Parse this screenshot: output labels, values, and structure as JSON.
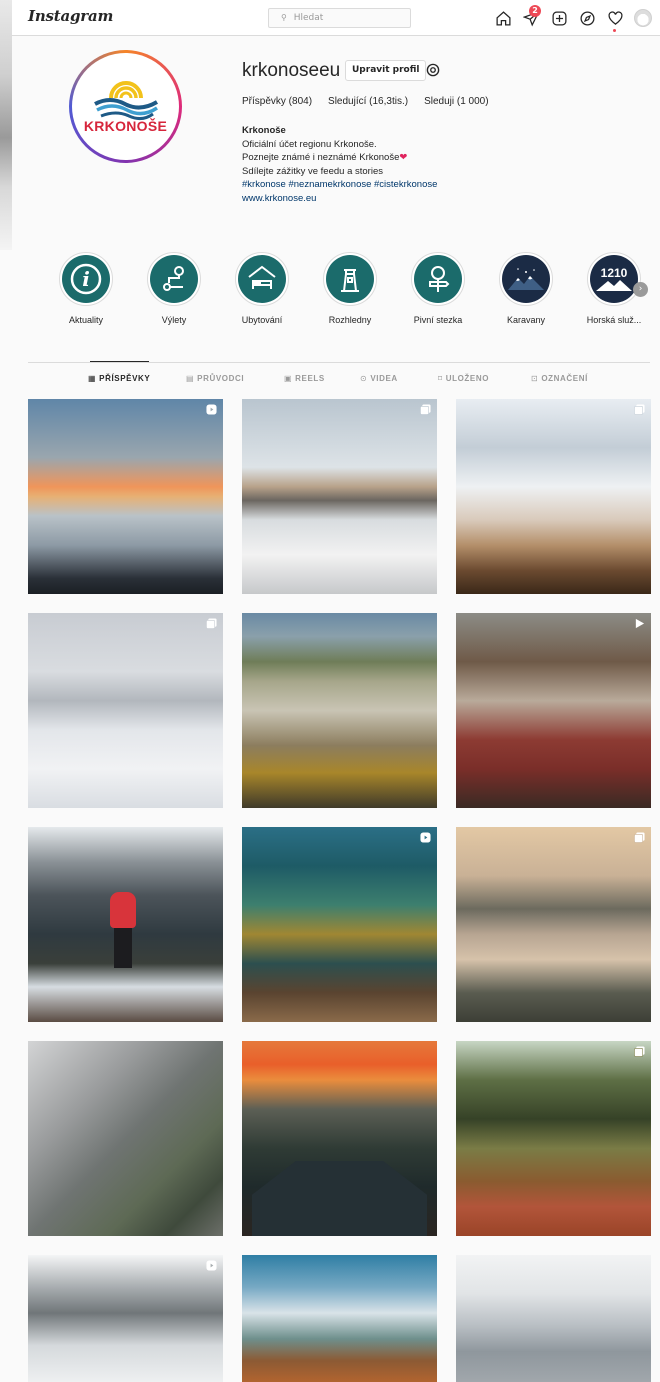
{
  "app": {
    "logo": "Instagram"
  },
  "search": {
    "placeholder": "Hledat"
  },
  "nav": {
    "direct_badge": "2"
  },
  "profile": {
    "username": "krkonoseeu",
    "edit_button": "Upravit profil",
    "logo_text": "KRKONOŠE",
    "stats": {
      "posts": "Příspěvky (804)",
      "followers": "Sledující (16,3tis.)",
      "following": "Sleduji (1 000)"
    },
    "bio": {
      "name": "Krkonoše",
      "line1": "Oficiální účet regionu Krkonoše.",
      "line2": "Poznejte známé i neznámé Krkonoše",
      "line3": "Sdílejte zážitky ve feedu a stories",
      "tags": "#krkonose #neznamekrkonose #cistekrkonose",
      "link": "www.krkonose.eu"
    }
  },
  "highlights": [
    {
      "label": "Aktuality",
      "icon": "info-icon"
    },
    {
      "label": "Výlety",
      "icon": "route-icon"
    },
    {
      "label": "Ubytování",
      "icon": "bed-icon"
    },
    {
      "label": "Rozhledny",
      "icon": "lookout-tower-icon"
    },
    {
      "label": "Pivní stezka",
      "icon": "beer-signpost-icon"
    },
    {
      "label": "Karavany",
      "icon": "night-mountains-icon"
    },
    {
      "label": "Horská služ...",
      "icon": "mountain-1210-icon",
      "badge_text": "1210"
    }
  ],
  "tabs": [
    {
      "label": "PŘÍSPĚVKY",
      "icon": "grid-icon",
      "active": true
    },
    {
      "label": "PRŮVODCI",
      "icon": "guides-icon",
      "active": false
    },
    {
      "label": "REELS",
      "icon": "reels-icon",
      "active": false
    },
    {
      "label": "VIDEA",
      "icon": "video-icon",
      "active": false
    },
    {
      "label": "ULOŽENO",
      "icon": "bookmark-icon",
      "active": false
    },
    {
      "label": "OZNAČENÍ",
      "icon": "tagged-icon",
      "active": false
    }
  ],
  "posts": [
    {
      "type": "reel",
      "scene": "sunset-over-clouds"
    },
    {
      "type": "carousel",
      "scene": "snowy-observatory"
    },
    {
      "type": "carousel",
      "scene": "sea-of-clouds"
    },
    {
      "type": "carousel",
      "scene": "frozen-tower"
    },
    {
      "type": "none",
      "scene": "foggy-valley"
    },
    {
      "type": "video",
      "scene": "bearded-man"
    },
    {
      "type": "none",
      "scene": "hiker-red-jacket"
    },
    {
      "type": "reel",
      "scene": "autumn-forest"
    },
    {
      "type": "carousel",
      "scene": "misty-forest"
    },
    {
      "type": "none",
      "scene": "rock-in-fog"
    },
    {
      "type": "none",
      "scene": "sunset-house"
    },
    {
      "type": "carousel",
      "scene": "twisted-trees"
    },
    {
      "type": "reel",
      "scene": "frosted-treetops"
    },
    {
      "type": "none",
      "scene": "castle-autumn"
    },
    {
      "type": "none",
      "scene": "misty-ridges"
    }
  ],
  "colors": {
    "accent_teal": "#1b6b6b",
    "link_blue": "#00376b",
    "badge_red": "#ed4956",
    "logo_red": "#d6253b"
  }
}
